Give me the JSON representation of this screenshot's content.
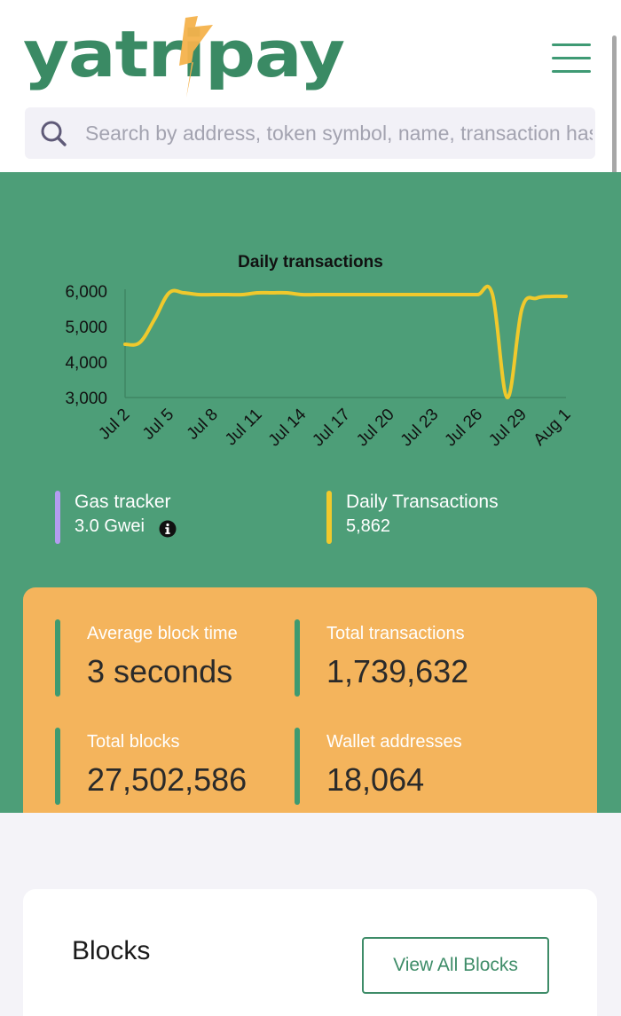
{
  "header": {
    "logo_text": "yatripay",
    "search_placeholder": "Search by address, token symbol, name, transaction hash, or block number"
  },
  "chart_data": {
    "type": "line",
    "title": "Daily transactions",
    "x": [
      "Jul 2",
      "Jul 3",
      "Jul 4",
      "Jul 5",
      "Jul 6",
      "Jul 7",
      "Jul 8",
      "Jul 9",
      "Jul 10",
      "Jul 11",
      "Jul 12",
      "Jul 13",
      "Jul 14",
      "Jul 15",
      "Jul 16",
      "Jul 17",
      "Jul 18",
      "Jul 19",
      "Jul 20",
      "Jul 21",
      "Jul 22",
      "Jul 23",
      "Jul 24",
      "Jul 25",
      "Jul 26",
      "Jul 27",
      "Jul 28",
      "Jul 29",
      "Jul 30",
      "Jul 31",
      "Aug 1"
    ],
    "tick_labels": [
      "Jul 2",
      "Jul 5",
      "Jul 8",
      "Jul 11",
      "Jul 14",
      "Jul 17",
      "Jul 20",
      "Jul 23",
      "Jul 26",
      "Jul 29",
      "Aug 1"
    ],
    "y": [
      4500,
      4550,
      5200,
      5950,
      5950,
      5900,
      5900,
      5900,
      5900,
      5950,
      5950,
      5950,
      5900,
      5900,
      5900,
      5900,
      5900,
      5900,
      5900,
      5900,
      5900,
      5900,
      5900,
      5900,
      5900,
      5900,
      3000,
      5500,
      5800,
      5850,
      5850
    ],
    "y_ticks": [
      "6,000",
      "5,000",
      "4,000",
      "3,000"
    ],
    "ylim": [
      3000,
      6000
    ],
    "line_color": "#f0c92c"
  },
  "stats": {
    "gas": {
      "label": "Gas tracker",
      "value": "3.0 Gwei",
      "color": "#b49cf0"
    },
    "daily": {
      "label": "Daily Transactions",
      "value": "5,862",
      "color": "#f0c92c"
    }
  },
  "metrics": [
    {
      "label": "Average block time",
      "value": "3 seconds"
    },
    {
      "label": "Total transactions",
      "value": "1,739,632"
    },
    {
      "label": "Total blocks",
      "value": "27,502,586"
    },
    {
      "label": "Wallet addresses",
      "value": "18,064"
    }
  ],
  "blocks": {
    "title": "Blocks",
    "view_all_label": "View All Blocks"
  },
  "colors": {
    "brand_green": "#3a8a64",
    "logo_accent": "#f4b24c",
    "section_green": "#4d9e78",
    "card_orange": "#f4b45c"
  }
}
